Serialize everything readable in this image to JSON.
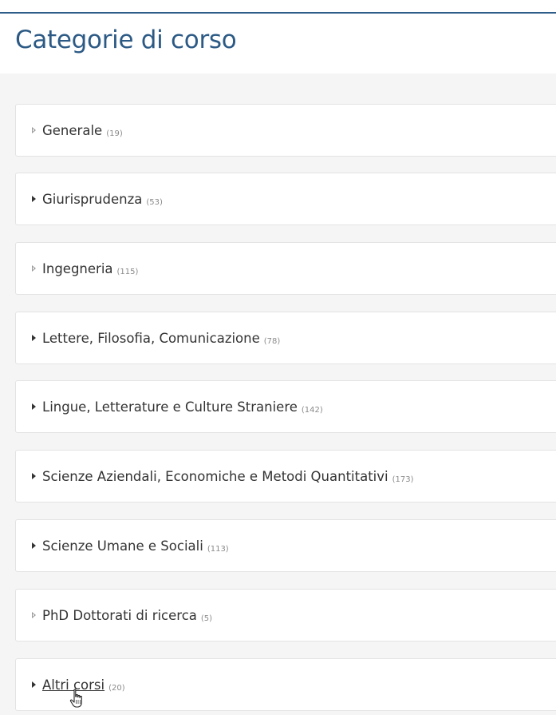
{
  "page": {
    "title": "Categorie di corso"
  },
  "categories": [
    {
      "name": "Generale",
      "count": "(19)",
      "icon": "triangle-outline-icon"
    },
    {
      "name": "Giurisprudenza",
      "count": "(53)",
      "icon": "triangle-filled-icon"
    },
    {
      "name": "Ingegneria",
      "count": "(115)",
      "icon": "triangle-outline-icon"
    },
    {
      "name": "Lettere, Filosofia, Comunicazione",
      "count": "(78)",
      "icon": "triangle-filled-icon"
    },
    {
      "name": "Lingue, Letterature e Culture Straniere",
      "count": "(142)",
      "icon": "triangle-filled-icon"
    },
    {
      "name": "Scienze Aziendali, Economiche e Metodi Quantitativi",
      "count": "(173)",
      "icon": "triangle-filled-icon"
    },
    {
      "name": "Scienze Umane e Sociali",
      "count": "(113)",
      "icon": "triangle-filled-icon"
    },
    {
      "name": "PhD Dottorati di ricerca",
      "count": "(5)",
      "icon": "triangle-outline-icon"
    },
    {
      "name": "Altri corsi",
      "count": "(20)",
      "icon": "triangle-filled-icon"
    }
  ],
  "colors": {
    "title": "#2c5a85",
    "background": "#f5f5f5",
    "card": "#ffffff"
  },
  "cursor": {
    "icon": "hand-pointer-icon"
  }
}
